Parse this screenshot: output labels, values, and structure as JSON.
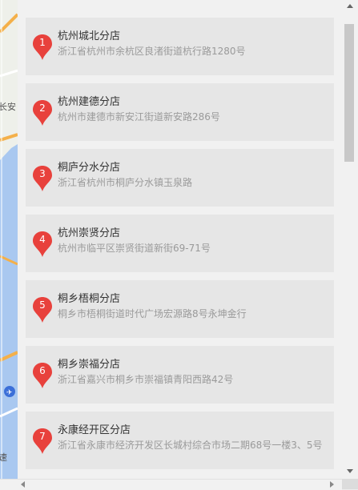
{
  "map": {
    "label_top": "长安",
    "label_bottom": "速"
  },
  "stores": [
    {
      "num": "1",
      "name": "杭州城北分店",
      "address": "浙江省杭州市余杭区良渚街道杭行路1280号"
    },
    {
      "num": "2",
      "name": "杭州建德分店",
      "address": "杭州市建德市新安江街道新安路286号"
    },
    {
      "num": "3",
      "name": "桐庐分水分店",
      "address": "浙江省杭州市桐庐分水镇玉泉路"
    },
    {
      "num": "4",
      "name": "杭州崇贤分店",
      "address": "杭州市临平区崇贤街道新街69-71号"
    },
    {
      "num": "5",
      "name": "桐乡梧桐分店",
      "address": "桐乡市梧桐街道时代广场宏源路8号永坤金行"
    },
    {
      "num": "6",
      "name": "桐乡崇福分店",
      "address": "浙江省嘉兴市桐乡市崇福镇青阳西路42号"
    },
    {
      "num": "7",
      "name": "永康经开区分店",
      "address": "浙江省永康市经济开发区长城村综合市场二期68号一楼3、5号"
    }
  ],
  "colors": {
    "pin": "#e8413c",
    "card": "#e6e6e6",
    "panel": "#f1f1f1"
  }
}
